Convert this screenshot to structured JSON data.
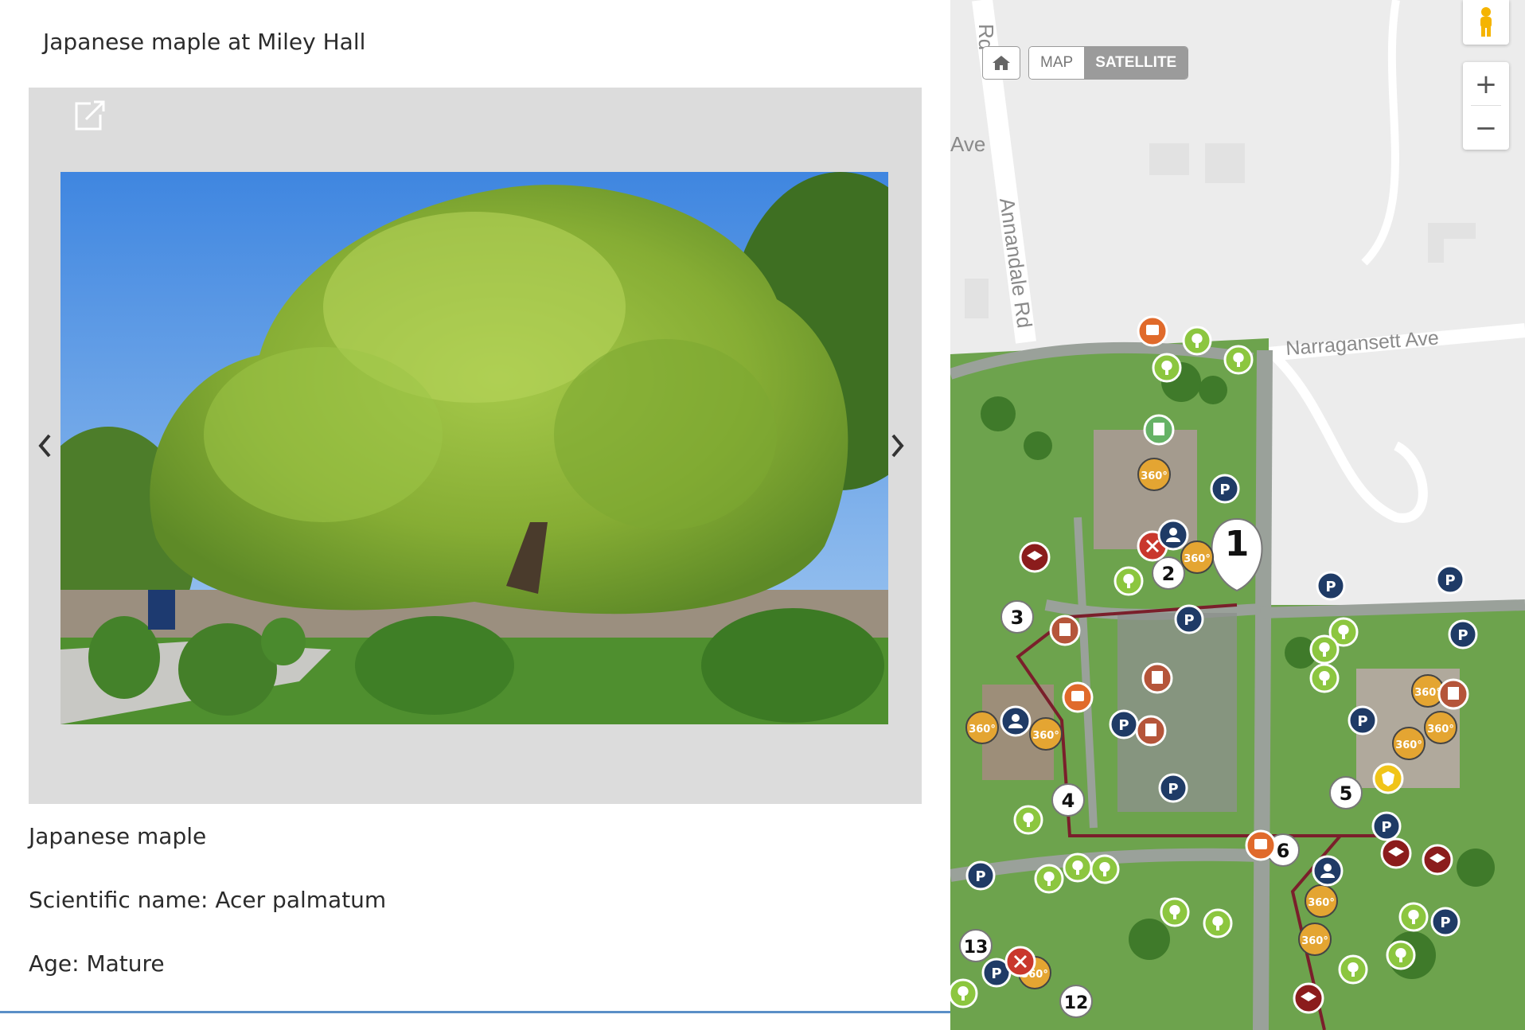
{
  "panel": {
    "title": "Japanese maple at Miley Hall",
    "common_name": "Japanese maple",
    "scientific_name": "Scientific name: Acer palmatum",
    "age": "Age: Mature"
  },
  "map": {
    "type_buttons": {
      "map": "MAP",
      "satellite": "SATELLITE"
    },
    "selected_type": "SATELLITE",
    "zoom_in": "+",
    "zoom_out": "−",
    "roads": [
      "Rd",
      "Ave",
      "Annandale Rd",
      "Narragansett Ave"
    ],
    "tour_stops": [
      "1",
      "2",
      "3",
      "4",
      "5",
      "6",
      "12",
      "13"
    ],
    "poi_legend": {
      "parking": "P",
      "panorama": "360°"
    },
    "colors": {
      "tour_route": "#7a1f2b",
      "parking_pin": "#1f3b66",
      "tree_pin": "#8cc63f",
      "food_pin": "#c9372c",
      "building_pin": "#b5553a",
      "bus_pin": "#e06a2b",
      "academic_pin": "#8b1c1c",
      "panorama_badge": "#e4a532",
      "grass": "#6da34d"
    }
  }
}
